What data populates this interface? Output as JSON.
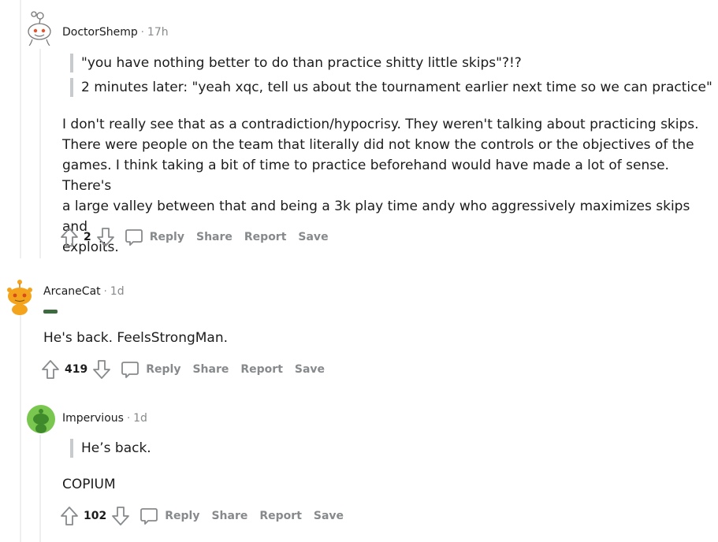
{
  "comments": [
    {
      "username": "DoctorShemp",
      "separator": "·",
      "time": "17h",
      "quotes": [
        "\"you have nothing better to do than practice shitty little skips\"?!?",
        "2 minutes later: \"yeah xqc, tell us about the tournament earlier next time so we can practice\""
      ],
      "body": [
        "I don't really see that as a contradiction/hypocrisy. They weren't talking about practicing skips.",
        "There were people on the team that literally did not know the controls or the objectives of the",
        "games. I think taking a bit of time to practice beforehand would have made a lot of sense. There's",
        "a large valley between that and being a 3k play time andy who aggressively maximizes skips and",
        "exploits."
      ],
      "votes": "2",
      "actions": {
        "reply": "Reply",
        "share": "Share",
        "report": "Report",
        "save": "Save"
      },
      "avatar_color": "#ffffff"
    },
    {
      "username": "ArcaneCat",
      "separator": "·",
      "time": "1d",
      "body": [
        "He's back. FeelsStrongMan."
      ],
      "votes": "419",
      "actions": {
        "reply": "Reply",
        "share": "Share",
        "report": "Report",
        "save": "Save"
      },
      "avatar_color": "#f4a41c"
    },
    {
      "username": "Impervious",
      "separator": "·",
      "time": "1d",
      "quotes": [
        "He’s back."
      ],
      "body": [
        "COPIUM"
      ],
      "votes": "102",
      "actions": {
        "reply": "Reply",
        "share": "Share",
        "report": "Report",
        "save": "Save"
      },
      "avatar_color": "#7ac74f"
    }
  ],
  "colors": {
    "meta": "#878a8c",
    "text": "#1c1c1c",
    "quote_bar": "#c8cbcd",
    "thread_line": "#edeff1"
  }
}
